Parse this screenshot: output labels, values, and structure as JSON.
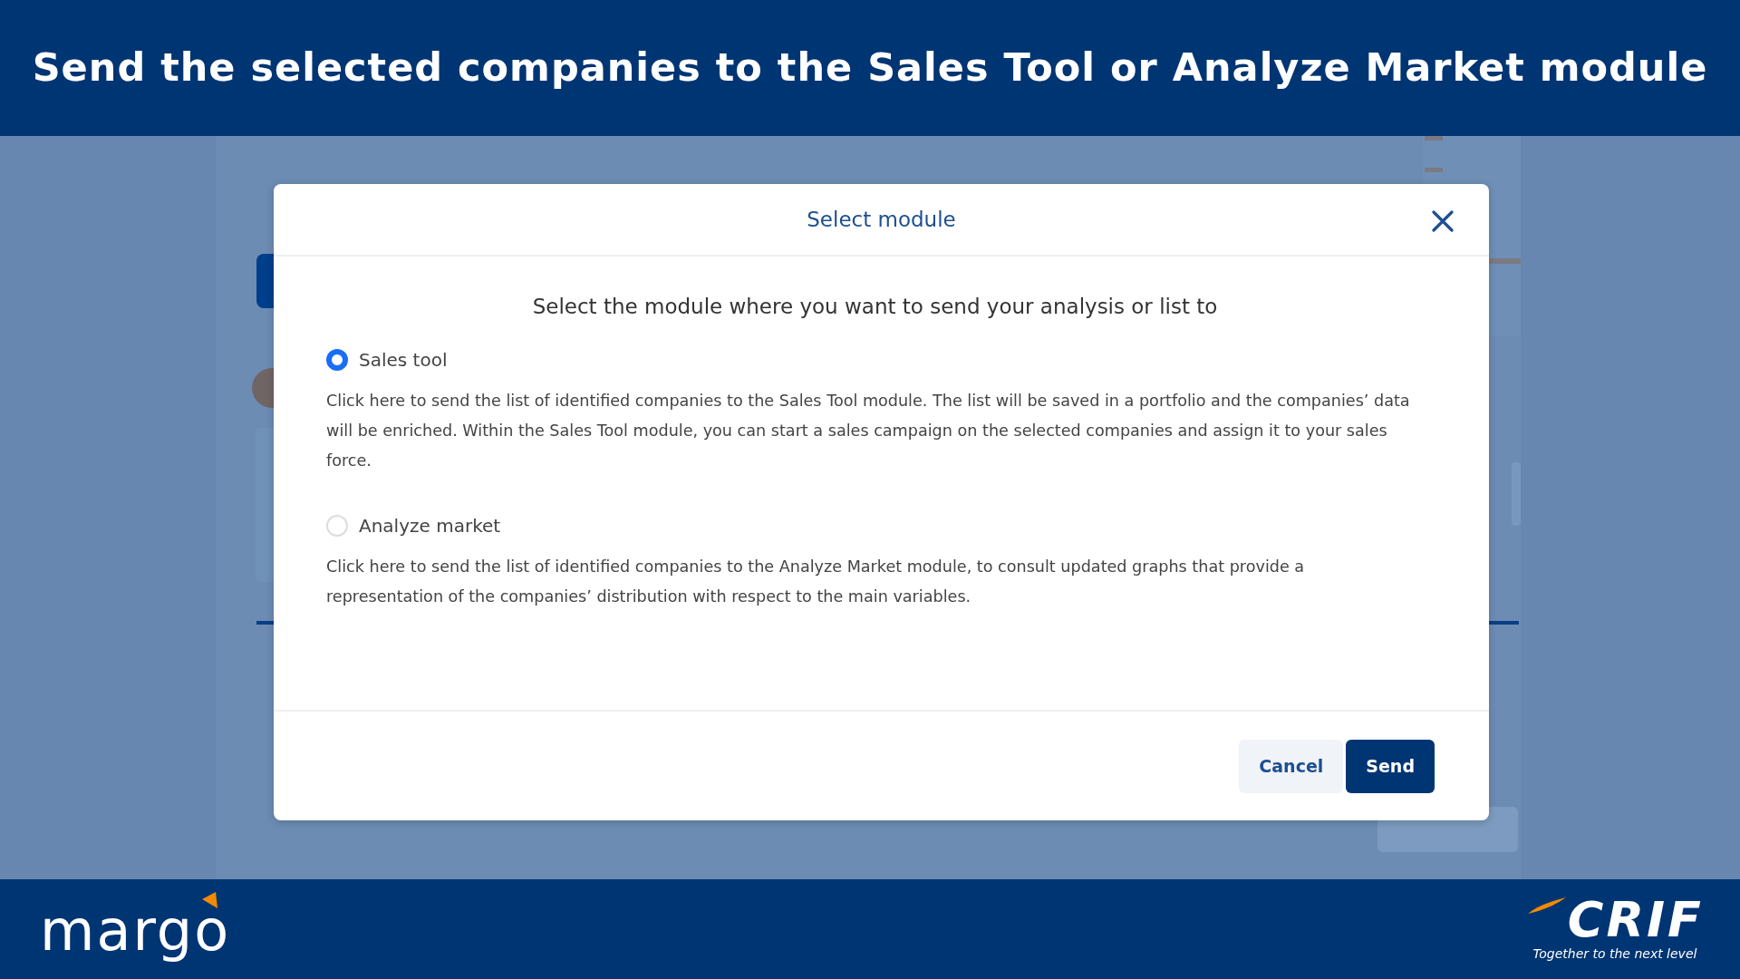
{
  "banner": {
    "title": "Send the selected companies to the Sales Tool or Analyze Market module"
  },
  "dialog": {
    "title": "Select module",
    "prompt": "Select the module where you want to send your analysis or list to",
    "options": [
      {
        "label": "Sales tool",
        "selected": true,
        "description": "Click here to send the list of identified companies to the Sales Tool module. The list will be saved in a portfolio and the companies’ data will be enriched. Within the Sales Tool module, you can start a sales campaign on the selected companies and assign it to your sales force."
      },
      {
        "label": "Analyze market",
        "selected": false,
        "description": "Click here to send the list of identified companies to the Analyze Market module, to consult updated graphs that provide a representation of the companies’ distribution with respect to the main variables."
      }
    ],
    "buttons": [
      {
        "label": "Cancel",
        "kind": "secondary"
      },
      {
        "label": "Send",
        "kind": "primary"
      }
    ]
  },
  "footer": {
    "left_logo": "margo",
    "right_logo": "CRIF",
    "tagline": "Together to the next level"
  }
}
